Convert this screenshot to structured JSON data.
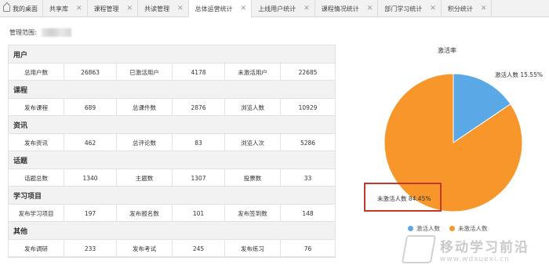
{
  "tabs": [
    {
      "label": "我的桌面",
      "closable": false,
      "active": false
    },
    {
      "label": "共享库",
      "closable": true,
      "active": false
    },
    {
      "label": "课程管理",
      "closable": true,
      "active": false
    },
    {
      "label": "共读管理",
      "closable": true,
      "active": false
    },
    {
      "label": "总体运营统计",
      "closable": true,
      "active": true
    },
    {
      "label": "上线用户统计",
      "closable": true,
      "active": false
    },
    {
      "label": "课程情况统计",
      "closable": true,
      "active": false
    },
    {
      "label": "部门学习统计",
      "closable": true,
      "active": false
    },
    {
      "label": "积分统计",
      "closable": true,
      "active": false
    }
  ],
  "scope": {
    "label": "管理范围:"
  },
  "sections": [
    {
      "title": "用户",
      "cells": [
        "总用户数",
        "26863",
        "已激活用户",
        "4178",
        "未激活用户",
        "22685"
      ]
    },
    {
      "title": "课程",
      "cells": [
        "发布课程",
        "689",
        "总课件数",
        "2876",
        "浏览人数",
        "10929"
      ]
    },
    {
      "title": "资讯",
      "cells": [
        "发布资讯",
        "462",
        "总评论数",
        "83",
        "浏览人次",
        "5286"
      ]
    },
    {
      "title": "话题",
      "cells": [
        "话题总数",
        "1340",
        "主题数",
        "1307",
        "投票数",
        "33"
      ]
    },
    {
      "title": "学习项目",
      "cells": [
        "发布学习项目",
        "197",
        "发布报名数",
        "101",
        "发布签到数",
        "148"
      ]
    },
    {
      "title": "其他",
      "cells": [
        "发布调研",
        "233",
        "发布考试",
        "245",
        "发布练习",
        "76"
      ]
    }
  ],
  "chart_data": {
    "type": "pie",
    "title": "激活率",
    "slices": [
      {
        "label": "激活人数",
        "value": 15.55,
        "color": "#5aa9e6"
      },
      {
        "label": "未激活人数",
        "value": 84.45,
        "color": "#f7962b"
      }
    ],
    "data_labels": [
      "激活人数 15.55%",
      "未激活人数 84.45%"
    ],
    "legend_position": "bottom"
  },
  "watermark": {
    "text": "移动学习前沿",
    "url": "www.wdxuexi.cn"
  }
}
